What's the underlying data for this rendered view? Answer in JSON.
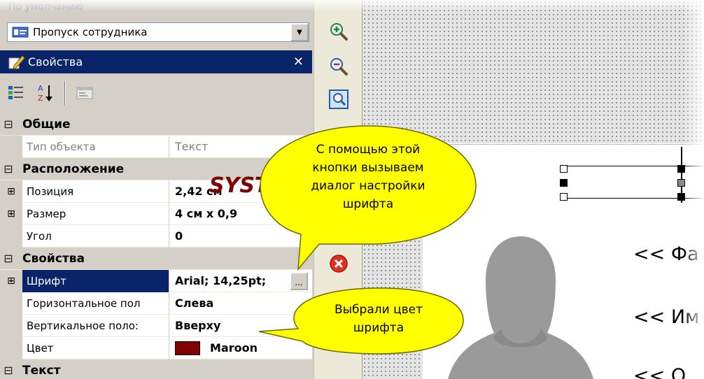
{
  "top_item": "По умолчанию",
  "combo": {
    "value": "Пропуск сотрудника"
  },
  "panel": {
    "title": "Свойства",
    "close": "✕"
  },
  "grid": {
    "cat_general": "Общие",
    "object_type": {
      "name": "Тип объекта",
      "value": "Текст"
    },
    "cat_position": "Расположение",
    "position": {
      "name": "Позиция",
      "value": "2,42 см"
    },
    "size": {
      "name": "Размер",
      "value": "4 см x 0,9"
    },
    "angle": {
      "name": "Угол",
      "value": "0"
    },
    "cat_properties": "Свойства",
    "font": {
      "name": "Шрифт",
      "value": "Arial; 14,25pt;",
      "button": "..."
    },
    "halign": {
      "name": "Горизонтальное пол",
      "value": "Слева"
    },
    "valign": {
      "name": "Вертикальное поло:",
      "value": "Вверху"
    },
    "color": {
      "name": "Цвет",
      "value": "Maroon",
      "swatch": "#800000"
    },
    "cat_text": "Текст"
  },
  "canvas": {
    "system_text": "SYSTEM",
    "field1": "<< Фа",
    "field2": "<< Им",
    "field3": "<< О"
  },
  "callouts": {
    "font_button_line1": "С помощью этой",
    "font_button_line2": "кнопки вызываем",
    "font_button_line3": "диалог настройки",
    "font_button_line4": "шрифта",
    "color_line1": "Выбрали цвет",
    "color_line2": "шрифта"
  },
  "colors": {
    "accent": "#0a246a",
    "callout": "#ffff00",
    "maroon": "#800000"
  }
}
